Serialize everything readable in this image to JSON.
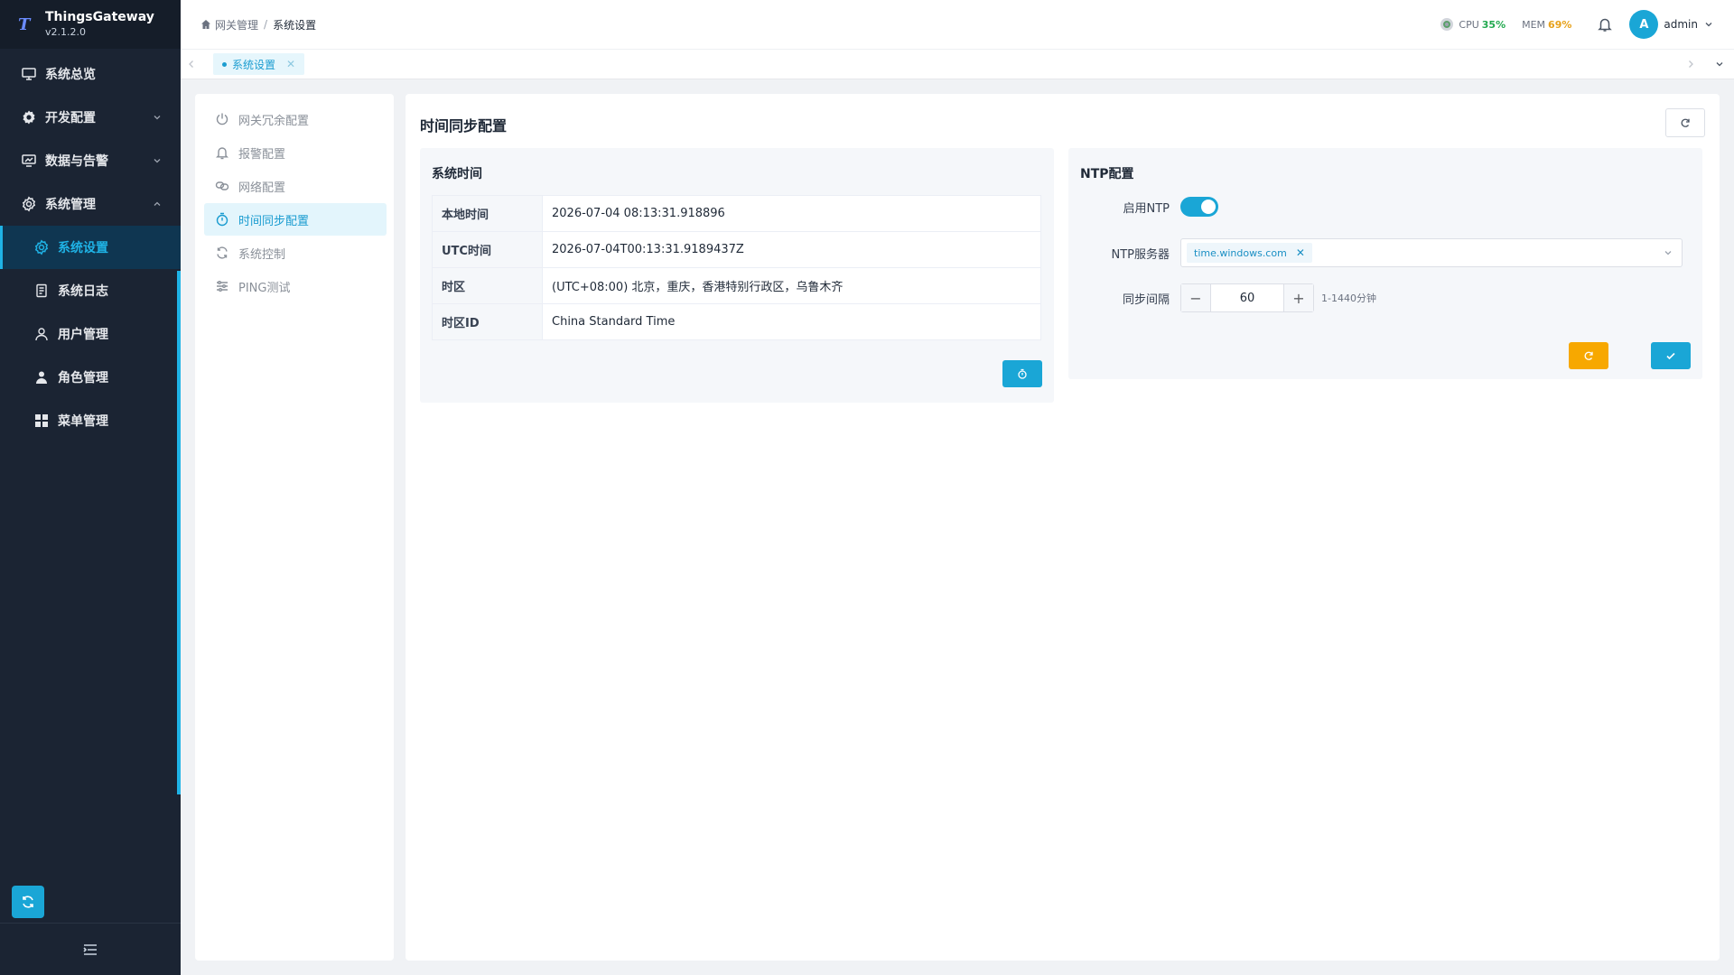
{
  "app": {
    "name": "ThingsGateway",
    "version": "v2.1.2.0"
  },
  "sidebar": {
    "items": [
      {
        "label": "系统总览"
      },
      {
        "label": "开发配置"
      },
      {
        "label": "数据与告警"
      },
      {
        "label": "系统管理"
      }
    ],
    "sub_items": [
      {
        "label": "系统设置"
      },
      {
        "label": "系统日志"
      },
      {
        "label": "用户管理"
      },
      {
        "label": "角色管理"
      },
      {
        "label": "菜单管理"
      }
    ],
    "accent": "#1fb3e6",
    "background": "#1b2433"
  },
  "header": {
    "breadcrumb": [
      "网关管理",
      "系统设置"
    ],
    "cpu_label": "CPU",
    "cpu_value": "35%",
    "mem_label": "MEM",
    "mem_value": "69%",
    "user_initial": "A",
    "user_name": "admin"
  },
  "tabs": [
    {
      "label": "系统设置",
      "close": "✕"
    }
  ],
  "settings_menu": [
    {
      "label": "网关冗余配置",
      "icon": "power-icon"
    },
    {
      "label": "报警配置",
      "icon": "bell-icon"
    },
    {
      "label": "网络配置",
      "icon": "link-icon"
    },
    {
      "label": "时间同步配置",
      "icon": "timer-icon"
    },
    {
      "label": "系统控制",
      "icon": "sync-icon"
    },
    {
      "label": "PING测试",
      "icon": "sliders-icon"
    }
  ],
  "main": {
    "title": "时间同步配置",
    "system_time": {
      "title": "系统时间",
      "rows": [
        {
          "key": "本地时间",
          "value": "2026-07-04 08:13:31.918896"
        },
        {
          "key": "UTC时间",
          "value": "2026-07-04T00:13:31.9189437Z"
        },
        {
          "key": "时区",
          "value": "(UTC+08:00) 北京，重庆，香港特别行政区，乌鲁木齐"
        },
        {
          "key": "时区ID",
          "value": "China Standard Time"
        }
      ]
    },
    "ntp": {
      "title": "NTP配置",
      "enable_label": "启用NTP",
      "enabled": true,
      "server_label": "NTP服务器",
      "server_value": "time.windows.com",
      "interval_label": "同步间隔",
      "interval_value": "60",
      "interval_minus": "−",
      "interval_plus": "+",
      "interval_hint": "1-1440分钟"
    }
  },
  "colors": {
    "primary": "#1aa6d6",
    "warning": "#f7a800",
    "cpu": "#22a94f",
    "mem": "#e7a11a"
  }
}
